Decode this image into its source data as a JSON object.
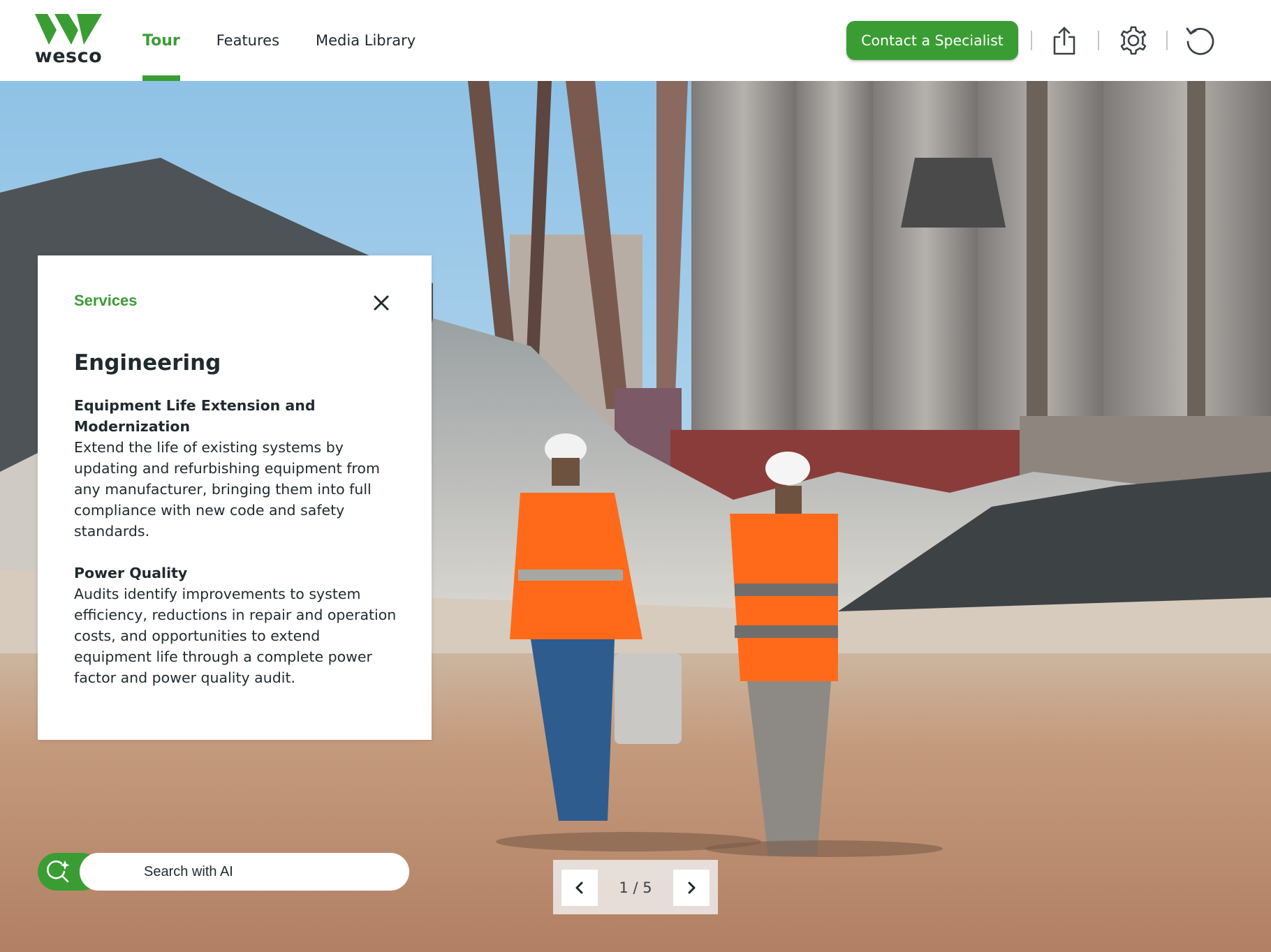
{
  "brand": {
    "name": "wesco",
    "accent_color": "#3a9d34",
    "text_color": "#1f2a2e"
  },
  "nav": {
    "tabs": [
      {
        "label": "Tour",
        "active": true
      },
      {
        "label": "Features",
        "active": false
      },
      {
        "label": "Media Library",
        "active": false
      }
    ]
  },
  "header": {
    "contact_label": "Contact a Specialist",
    "icons": [
      "share-icon",
      "gear-icon",
      "reset-icon"
    ]
  },
  "panel": {
    "category": "Services",
    "title": "Engineering",
    "sections": [
      {
        "heading": "Equipment Life Extension and Modernization",
        "body": "Extend the life of existing systems by updating and refurbishing equipment from any manufacturer, bringing them into full compliance with new code and safety standards."
      },
      {
        "heading": "Power Quality",
        "body": "Audits identify improvements to system efficiency, reductions in repair and operation costs, and opportunities to extend equipment life through a complete power factor and power quality audit."
      }
    ],
    "close_icon": "close-icon"
  },
  "search": {
    "placeholder": "Search with AI",
    "icon": "ai-search-icon"
  },
  "pager": {
    "current": 1,
    "total": 5,
    "label": "1 / 5"
  }
}
